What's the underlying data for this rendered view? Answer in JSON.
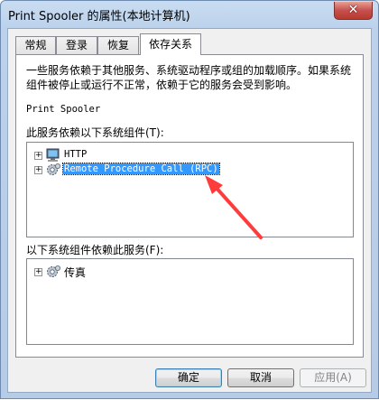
{
  "window": {
    "title": "Print Spooler 的属性(本地计算机)",
    "close_label": "✕"
  },
  "tabs": [
    {
      "label": "常规",
      "active": false
    },
    {
      "label": "登录",
      "active": false
    },
    {
      "label": "恢复",
      "active": false
    },
    {
      "label": "依存关系",
      "active": true
    }
  ],
  "panel": {
    "description": "一些服务依赖于其他服务、系统驱动程序或组的加载顺序。如果系统组件被停止或运行不正常，依赖于它的服务会受到影响。",
    "service_name": "Print Spooler",
    "depends_on_label": "此服务依赖以下系统组件(T):",
    "depends_on": [
      {
        "label": "HTTP",
        "icon": "computer-icon",
        "expander": "+",
        "selected": false
      },
      {
        "label": "Remote Procedure Call (RPC)",
        "icon": "service-gear-icon",
        "expander": "+",
        "selected": true
      }
    ],
    "dependents_label": "以下系统组件依赖此服务(F):",
    "dependents": [
      {
        "label": "传真",
        "icon": "service-gear-icon",
        "expander": "+",
        "selected": false
      }
    ]
  },
  "buttons": {
    "ok": "确定",
    "cancel": "取消",
    "apply": "应用(A)"
  },
  "annotation": {
    "color": "#ff3b3b",
    "icon": "red-arrow-icon"
  }
}
